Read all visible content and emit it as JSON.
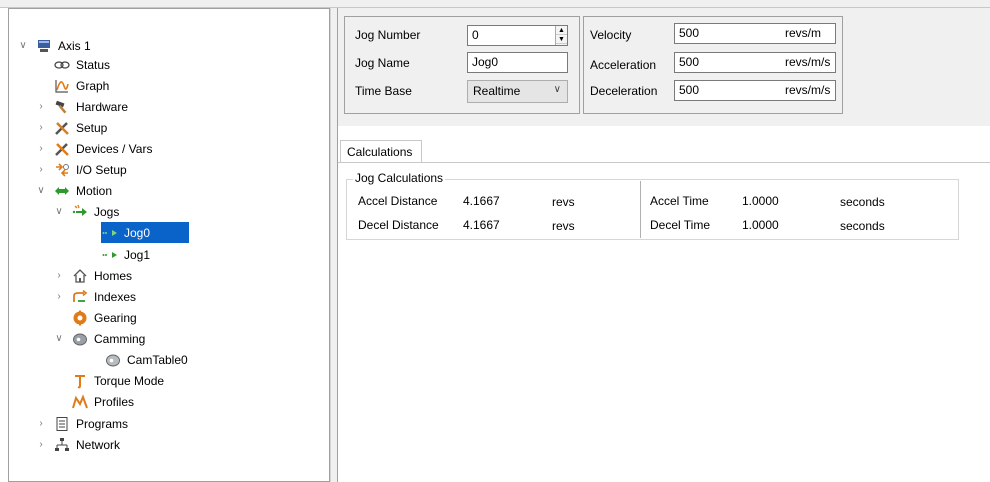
{
  "tree": {
    "items": [
      {
        "label": "Axis 1",
        "icon": "axis-drive-icon",
        "expand": "expanded"
      },
      {
        "label": "Status",
        "icon": "status-link-icon",
        "expand": "none"
      },
      {
        "label": "Graph",
        "icon": "graph-icon",
        "expand": "none"
      },
      {
        "label": "Hardware",
        "icon": "hammer-icon",
        "expand": "collapsed"
      },
      {
        "label": "Setup",
        "icon": "setup-tools-icon",
        "expand": "collapsed"
      },
      {
        "label": "Devices / Vars",
        "icon": "devices-tools-icon",
        "expand": "collapsed"
      },
      {
        "label": "I/O Setup",
        "icon": "io-setup-icon",
        "expand": "collapsed"
      },
      {
        "label": "Motion",
        "icon": "motion-arrows-icon",
        "expand": "expanded"
      },
      {
        "label": "Jogs",
        "icon": "jogs-icon",
        "expand": "expanded"
      },
      {
        "label": "Jog0",
        "icon": "jog-arrow-icon",
        "expand": "none",
        "selected": true
      },
      {
        "label": "Jog1",
        "icon": "jog-arrow-icon",
        "expand": "none"
      },
      {
        "label": "Homes",
        "icon": "home-icon",
        "expand": "collapsed"
      },
      {
        "label": "Indexes",
        "icon": "indexes-icon",
        "expand": "collapsed"
      },
      {
        "label": "Gearing",
        "icon": "gear-icon",
        "expand": "none"
      },
      {
        "label": "Camming",
        "icon": "cam-icon",
        "expand": "expanded"
      },
      {
        "label": "CamTable0",
        "icon": "cam-table-icon",
        "expand": "none"
      },
      {
        "label": "Torque Mode",
        "icon": "torque-icon",
        "expand": "none"
      },
      {
        "label": "Profiles",
        "icon": "profiles-icon",
        "expand": "none"
      },
      {
        "label": "Programs",
        "icon": "programs-icon",
        "expand": "collapsed"
      },
      {
        "label": "Network",
        "icon": "network-icon",
        "expand": "collapsed"
      }
    ]
  },
  "jog": {
    "number_label": "Jog Number",
    "number_value": "0",
    "name_label": "Jog Name",
    "name_value": "Jog0",
    "timebase_label": "Time Base",
    "timebase_value": "Realtime"
  },
  "motion": {
    "velocity_label": "Velocity",
    "velocity_value": "500",
    "velocity_unit": "revs/m",
    "accel_label": "Acceleration",
    "accel_value": "500",
    "accel_unit": "revs/m/s",
    "decel_label": "Deceleration",
    "decel_value": "500",
    "decel_unit": "revs/m/s"
  },
  "tabs": {
    "calculations": "Calculations"
  },
  "calc": {
    "title": "Jog Calculations",
    "accel_dist_label": "Accel Distance",
    "accel_dist_value": "4.1667",
    "accel_dist_unit": "revs",
    "decel_dist_label": "Decel Distance",
    "decel_dist_value": "4.1667",
    "decel_dist_unit": "revs",
    "accel_time_label": "Accel Time",
    "accel_time_value": "1.0000",
    "accel_time_unit": "seconds",
    "decel_time_label": "Decel Time",
    "decel_time_value": "1.0000",
    "decel_time_unit": "seconds"
  },
  "colors": {
    "selection": "#0a63c9",
    "motion_green": "#2e9a2e",
    "orange": "#e07b1a"
  }
}
